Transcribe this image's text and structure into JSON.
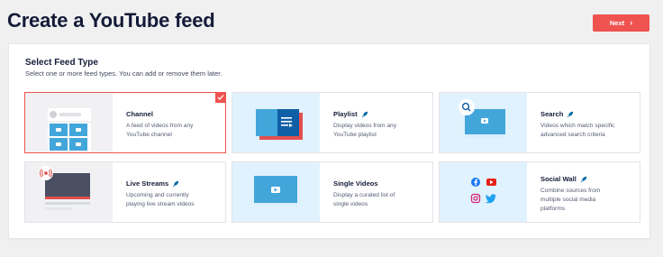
{
  "header": {
    "title": "Create a YouTube feed",
    "next_label": "Next"
  },
  "panel": {
    "title": "Select Feed Type",
    "subtitle": "Select one or more feed types. You can add or remove them later."
  },
  "cards": [
    {
      "title": "Channel",
      "desc1": "A feed of videos from any",
      "desc2": "YouTube channel",
      "selected": true,
      "pro": false
    },
    {
      "title": "Playlist",
      "desc1": "Display videos from any",
      "desc2": "YouTube playlist",
      "selected": false,
      "pro": true
    },
    {
      "title": "Search",
      "desc1": "Videos which match specific",
      "desc2": "advanced search criteria",
      "selected": false,
      "pro": true
    },
    {
      "title": "Live Streams",
      "desc1": "Upcoming and currently",
      "desc2": "playing live stream videos",
      "selected": false,
      "pro": true
    },
    {
      "title": "Single Videos",
      "desc1": "Display a curated list of",
      "desc2": "single videos",
      "selected": false,
      "pro": false
    },
    {
      "title": "Social Wall",
      "desc1": "Combine sources from",
      "desc2": "multiple social media",
      "desc3": "platforms",
      "selected": false,
      "pro": true
    }
  ],
  "colors": {
    "accent": "#ef5350",
    "youtube_blue": "#0096cc",
    "thumb_blue": "#e0f2fd"
  },
  "icons": [
    "checkmark-icon",
    "rocket-icon",
    "search-icon",
    "live-icon",
    "facebook-icon",
    "youtube-icon",
    "instagram-icon",
    "twitter-icon",
    "chevron-right-icon"
  ]
}
